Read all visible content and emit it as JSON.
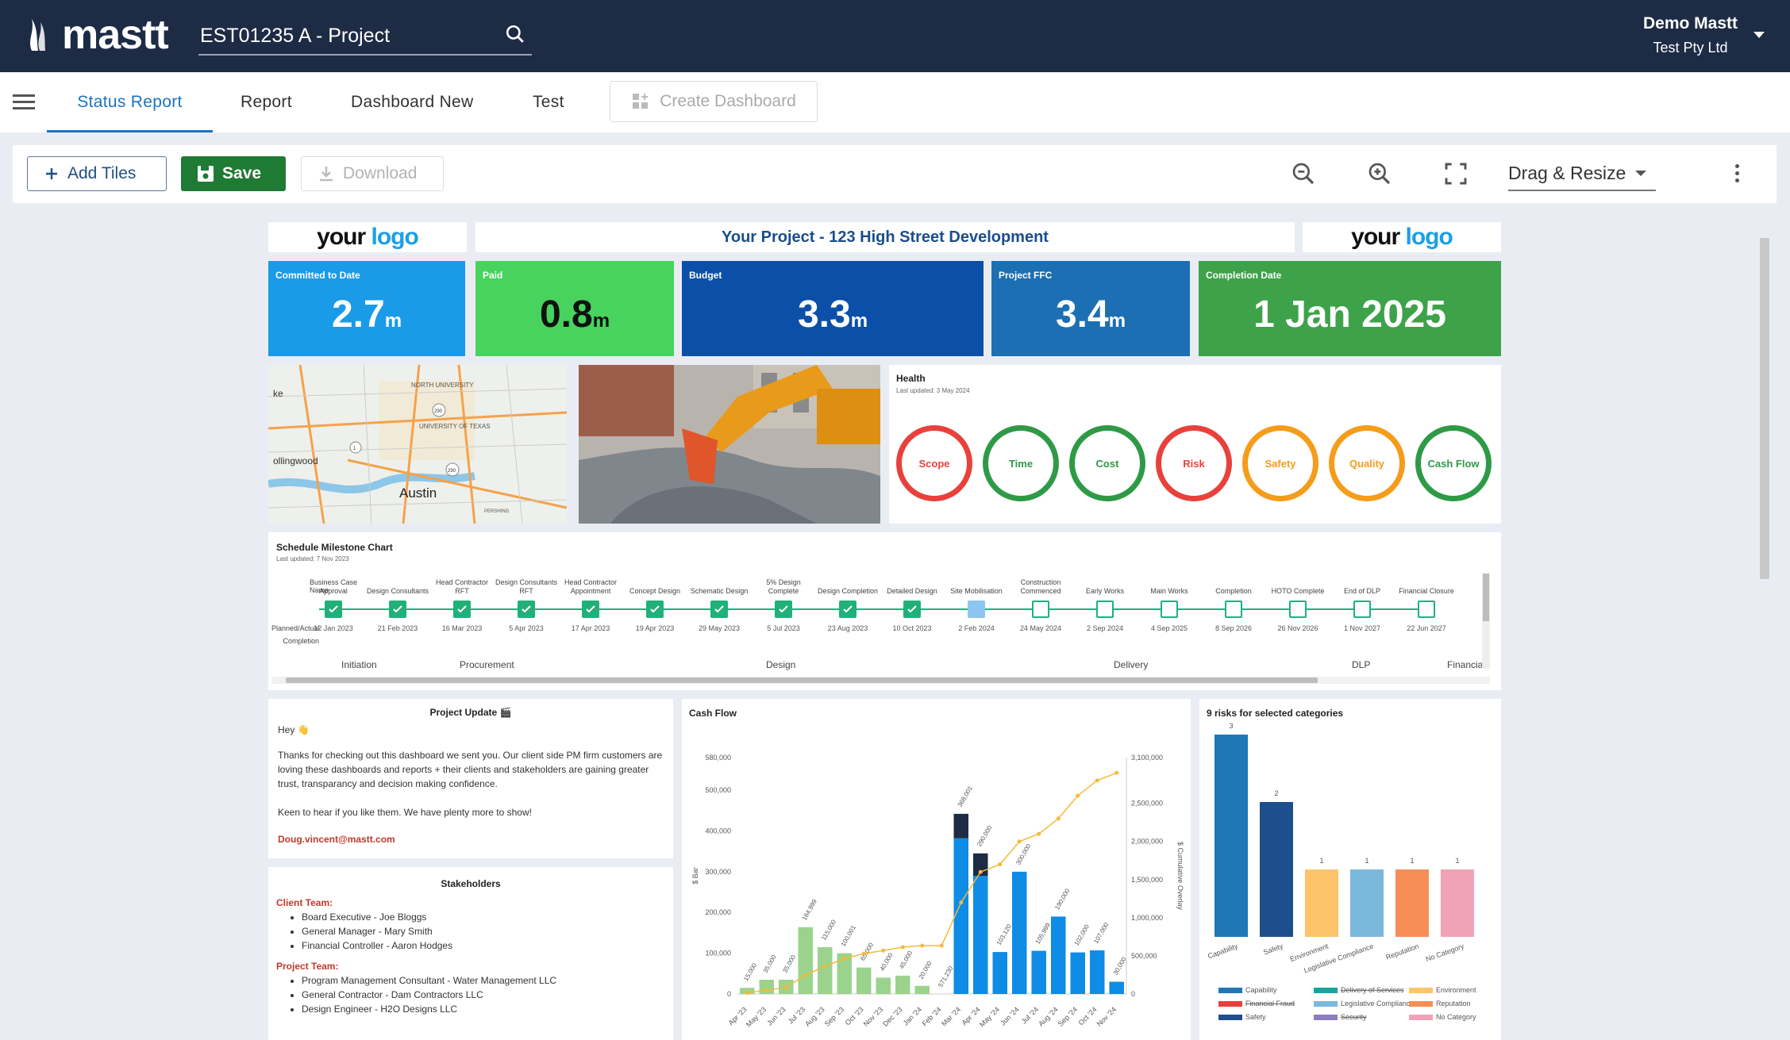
{
  "app": {
    "brand": "mastt",
    "search_value": "EST01235 A - Project",
    "user_name": "Demo Mastt",
    "user_org": "Test Pty Ltd"
  },
  "tabs": [
    {
      "label": "Status Report",
      "active": true
    },
    {
      "label": "Report"
    },
    {
      "label": "Dashboard New"
    },
    {
      "label": "Test"
    }
  ],
  "create_dashboard": "Create Dashboard",
  "toolbar": {
    "add_tiles": "Add Tiles",
    "save": "Save",
    "download": "Download",
    "mode": "Drag & Resize"
  },
  "logo": {
    "your": "your",
    "logo": "logo"
  },
  "project_title": "Your Project - 123 High Street Development",
  "kpis": [
    {
      "label": "Committed to Date",
      "value": "2.7",
      "unit": "m",
      "color": "#1a9be8"
    },
    {
      "label": "Paid",
      "value": "0.8",
      "unit": "m",
      "color": "#47d35d"
    },
    {
      "label": "Budget",
      "value": "3.3",
      "unit": "m",
      "color": "#0b4fa8"
    },
    {
      "label": "Project FFC",
      "value": "3.4",
      "unit": "m",
      "color": "#1c6fb2"
    },
    {
      "label": "Completion Date",
      "value": "1 Jan 2025",
      "unit": "",
      "color": "#3ea24a"
    }
  ],
  "map": {
    "labels": [
      "NORTH UNIVERSITY",
      "UNIVERSITY OF TEXAS",
      "ollingwood",
      "Austin",
      "ke",
      "PERSHING",
      "290",
      "290",
      "1"
    ]
  },
  "health": {
    "title": "Health",
    "updated": "Last updated: 3 May 2024",
    "items": [
      {
        "name": "Scope",
        "color": "#e8413c"
      },
      {
        "name": "Time",
        "color": "#2f9a46"
      },
      {
        "name": "Cost",
        "color": "#2f9a46"
      },
      {
        "name": "Risk",
        "color": "#e8413c"
      },
      {
        "name": "Safety",
        "color": "#f59c1a"
      },
      {
        "name": "Quality",
        "color": "#f59c1a"
      },
      {
        "name": "Cash Flow",
        "color": "#2f9a46"
      }
    ]
  },
  "schedule": {
    "title": "Schedule Milestone Chart",
    "updated": "Last updated: 7 Nov 2023",
    "name_label": "Name",
    "completion_label": "Planned/Actual Completion",
    "milestones": [
      {
        "name": "Business Case Approval",
        "date": "12 Jan 2023",
        "state": "done"
      },
      {
        "name": "Design Consultants",
        "date": "21 Feb 2023",
        "state": "done"
      },
      {
        "name": "Head Contractor RFT",
        "date": "16 Mar 2023",
        "state": "done"
      },
      {
        "name": "Design Consultants RFT",
        "date": "5 Apr 2023",
        "state": "done"
      },
      {
        "name": "Head Contractor Appointment",
        "date": "17 Apr 2023",
        "state": "done"
      },
      {
        "name": "Concept Design",
        "date": "19 Apr 2023",
        "state": "done"
      },
      {
        "name": "Schematic Design",
        "date": "29 May 2023",
        "state": "done"
      },
      {
        "name": "5% Design Complete",
        "date": "5 Jul 2023",
        "state": "done"
      },
      {
        "name": "Design Completion",
        "date": "23 Aug 2023",
        "state": "done"
      },
      {
        "name": "Detailed Design",
        "date": "10 Oct 2023",
        "state": "done"
      },
      {
        "name": "Site Mobilisation",
        "date": "2 Feb 2024",
        "state": "current"
      },
      {
        "name": "Construction Commenced",
        "date": "24 May 2024",
        "state": "open"
      },
      {
        "name": "Early Works",
        "date": "2 Sep 2024",
        "state": "open"
      },
      {
        "name": "Main Works",
        "date": "4 Sep 2025",
        "state": "open"
      },
      {
        "name": "Completion",
        "date": "8 Sep 2026",
        "state": "open"
      },
      {
        "name": "HOTO Complete",
        "date": "26 Nov 2026",
        "state": "open"
      },
      {
        "name": "End of DLP",
        "date": "1 Nov 2027",
        "state": "open"
      },
      {
        "name": "Financial Closure",
        "date": "22 Jun 2027",
        "state": "open"
      }
    ],
    "phases": [
      "Initiation",
      "Procurement",
      "Design",
      "Delivery",
      "DLP",
      "Financia"
    ]
  },
  "update": {
    "title": "Project Update",
    "greet": "Hey",
    "body": "Thanks for checking out this dashboard we sent you. Our client side PM firm customers are loving these dashboards and reports + their clients and stakeholders are gaining greater trust, transparancy and decision making confidence.",
    "body2": "Keen to hear if you like them. We have plenty more to show!",
    "email": "Doug.vincent@mastt.com"
  },
  "stakeholders": {
    "title": "Stakeholders",
    "client_head": "Client Team:",
    "client": [
      "Board Executive - Joe Bloggs",
      "General Manager - Mary Smith",
      "Financial Controller - Aaron Hodges"
    ],
    "project_head": "Project Team:",
    "project": [
      "Program Management Consultant - Water Management LLC",
      "General Contractor - Dam Contractors LLC",
      "Design Engineer - H2O Designs LLC"
    ]
  },
  "chart_data": [
    {
      "type": "bar",
      "title": "Cash Flow",
      "ylabel": "$ Bar",
      "y2label": "$ Cumulative Overlay",
      "ylim": [
        0,
        580000
      ],
      "y2lim": [
        0,
        3100000
      ],
      "yticks": [
        "0",
        "100,000",
        "200,000",
        "300,000",
        "400,000",
        "500,000",
        "580,000"
      ],
      "y2ticks": [
        "0",
        "500,000",
        "1,000,000",
        "1,500,000",
        "2,000,000",
        "2,500,000",
        "3,100,000"
      ],
      "categories": [
        "Apr '23",
        "May '23",
        "Jun '23",
        "Jul '23",
        "Aug '23",
        "Sep '23",
        "Oct '23",
        "Nov '23",
        "Dec '23",
        "Jan '24",
        "Feb '24",
        "Mar '24",
        "Apr '24",
        "May '24",
        "Jun '24",
        "Jul '24",
        "Aug '24",
        "Sep '24",
        "Oct '24",
        "Nov '24"
      ],
      "series": [
        {
          "name": "Paid",
          "color": "#9bd38c",
          "values": [
            15000,
            35000,
            35000,
            164000,
            115000,
            100000,
            65000,
            40000,
            45000,
            20000,
            0,
            0,
            0,
            0,
            0,
            0,
            0,
            0,
            0,
            0
          ]
        },
        {
          "name": "Committed",
          "color": "#0e8ce6",
          "values": [
            0,
            0,
            0,
            0,
            0,
            0,
            0,
            0,
            0,
            0,
            0,
            382000,
            290000,
            103000,
            300000,
            106000,
            190000,
            102000,
            107000,
            30000
          ]
        },
        {
          "name": "Forecast",
          "color": "#1e2b45",
          "values": [
            0,
            0,
            0,
            0,
            0,
            0,
            0,
            0,
            0,
            0,
            0,
            60000,
            55000,
            0,
            0,
            0,
            0,
            0,
            0,
            0
          ]
        },
        {
          "name": "Cumulative",
          "color": "#f4b93c",
          "values": [
            15000,
            50000,
            85000,
            249000,
            364000,
            464000,
            529000,
            569000,
            614000,
            634000,
            634000,
            1200000,
            1600000,
            1700000,
            2000000,
            2100000,
            2300000,
            2600000,
            2800000,
            2900000
          ]
        }
      ],
      "labels": [
        "15,000",
        "35,000",
        "35,000",
        "164,999",
        "115,000",
        "100,001",
        "65,000",
        "40,000",
        "45,000",
        "20,000",
        "571,230",
        "368,001",
        "290,000",
        "103,120",
        "300,000",
        "105,999",
        "190,000",
        "102,000",
        "107,000",
        "30,000"
      ]
    },
    {
      "type": "bar",
      "title": "9 risks for selected categories",
      "categories": [
        "Capability",
        "Safety",
        "Environment",
        "Legislative Compliance",
        "Reputation",
        "No Category"
      ],
      "values": [
        3,
        2,
        1,
        1,
        1,
        1
      ],
      "colors": [
        "#1f77b4",
        "#1f4e8c",
        "#fdc46b",
        "#7ab8dc",
        "#f78e56",
        "#f2a2b6"
      ],
      "legend": [
        {
          "name": "Capability",
          "color": "#1f77b4"
        },
        {
          "name": "Delivery of Services",
          "color": "#1aa39b"
        },
        {
          "name": "Environment",
          "color": "#fdc46b"
        },
        {
          "name": "Financial Fraud",
          "color": "#e8413c"
        },
        {
          "name": "Legislative Compliance",
          "color": "#7ab8dc"
        },
        {
          "name": "Reputation",
          "color": "#f78e56"
        },
        {
          "name": "Safety",
          "color": "#1f4e8c"
        },
        {
          "name": "Security",
          "color": "#8e7cc3"
        },
        {
          "name": "No Category",
          "color": "#f2a2b6"
        }
      ]
    }
  ]
}
